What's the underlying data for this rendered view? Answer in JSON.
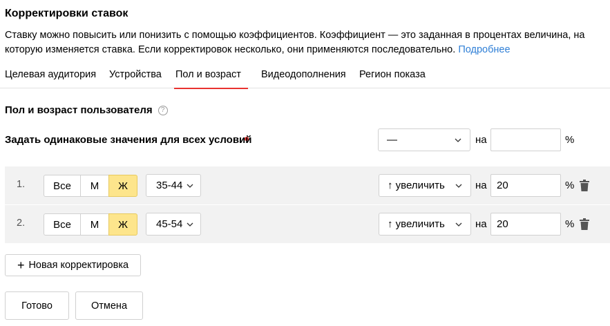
{
  "header": {
    "title": "Корректировки ставок",
    "description": "Ставку можно повысить или понизить с помощью коэффициентов. Коэффициент — это заданная в процентах величина, на которую изменяется ставка. Если корректировок несколько, они применяются последовательно.",
    "more_link": "Подробнее"
  },
  "tabs": [
    {
      "label": "Целевая аудитория"
    },
    {
      "label": "Устройства"
    },
    {
      "label": "Пол и возраст",
      "active": true
    },
    {
      "label": "Видеодополнения"
    },
    {
      "label": "Регион показа"
    }
  ],
  "section": {
    "title": "Пол и возраст пользователя",
    "help": "?"
  },
  "all_conditions": {
    "label": "Задать одинаковые значения для всех условий",
    "select_value": "—",
    "on_label": "на",
    "input_value": "",
    "percent": "%"
  },
  "rows": [
    {
      "num": "1.",
      "gender_options": [
        "Все",
        "М",
        "Ж"
      ],
      "gender_selected": "Ж",
      "age": "35-44",
      "action": "↑ увеличить",
      "on_label": "на",
      "value": "20",
      "percent": "%"
    },
    {
      "num": "2.",
      "gender_options": [
        "Все",
        "М",
        "Ж"
      ],
      "gender_selected": "Ж",
      "age": "45-54",
      "action": "↑ увеличить",
      "on_label": "на",
      "value": "20",
      "percent": "%"
    }
  ],
  "actions": {
    "add_label": "Новая корректировка",
    "add_icon": "+",
    "done_label": "Готово",
    "cancel_label": "Отмена"
  },
  "colors": {
    "accent_red": "#e8322f",
    "link_blue": "#2f7fd6",
    "selected_yellow": "#fde58c",
    "row_bg": "#f2f2f2"
  }
}
